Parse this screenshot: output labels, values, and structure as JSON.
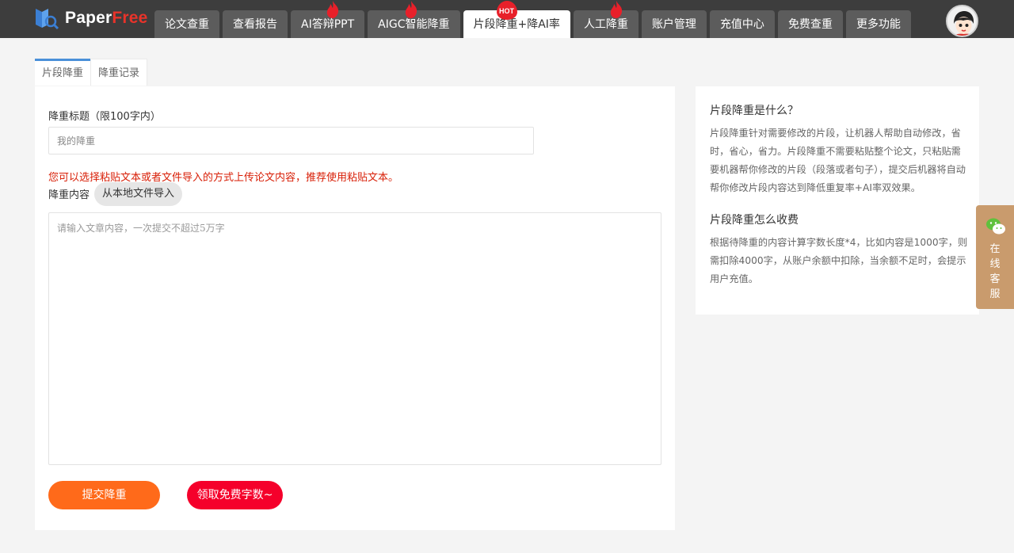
{
  "header": {
    "logo_text_a": "Paper",
    "logo_text_b": "Free",
    "nav": [
      {
        "label": "论文查重",
        "badge": ""
      },
      {
        "label": "查看报告",
        "badge": ""
      },
      {
        "label": "AI答辩PPT",
        "badge": "fire"
      },
      {
        "label": "AIGC智能降重",
        "badge": "fire"
      },
      {
        "label": "片段降重+降AI率",
        "badge": "HOT"
      },
      {
        "label": "人工降重",
        "badge": "fire"
      },
      {
        "label": "账户管理",
        "badge": ""
      },
      {
        "label": "充值中心",
        "badge": ""
      },
      {
        "label": "免费查重",
        "badge": ""
      },
      {
        "label": "更多功能",
        "badge": ""
      }
    ],
    "active_nav": "片段降重+降AI率"
  },
  "tabs": {
    "first": "片段降重",
    "second": "降重记录"
  },
  "form": {
    "title_label": "降重标题（限100字内）",
    "title_placeholder": "我的降重",
    "warning": "您可以选择粘贴文本或者文件导入的方式上传论文内容，推荐使用粘贴文本。",
    "content_label": "降重内容",
    "import_button": "从本地文件导入",
    "content_placeholder": "请输入文章内容，一次提交不超过5万字",
    "submit_button": "提交降重",
    "free_button": "领取免费字数~"
  },
  "info": {
    "q1": "片段降重是什么？",
    "a1": "片段降重针对需要修改的片段，让机器人帮助自动修改，省时，省心，省力。片段降重不需要粘贴整个论文，只粘贴需要机器帮你修改的片段（段落或者句子），提交后机器将自动帮你修改片段内容达到降低重复率+AI率双效果。",
    "q2": "片段降重怎么收费",
    "a2": "根据待降重的内容计算字数长度*4，比如内容是1000字，则需扣除4000字，从账户余额中扣除，当余额不足时，会提示用户充值。"
  },
  "service": {
    "label": "在线客服"
  },
  "colors": {
    "accent": "#4a90d9",
    "submit": "#ff6a1a",
    "free": "#f5002b",
    "warning": "#d81e06",
    "service": "#c99b6d"
  }
}
